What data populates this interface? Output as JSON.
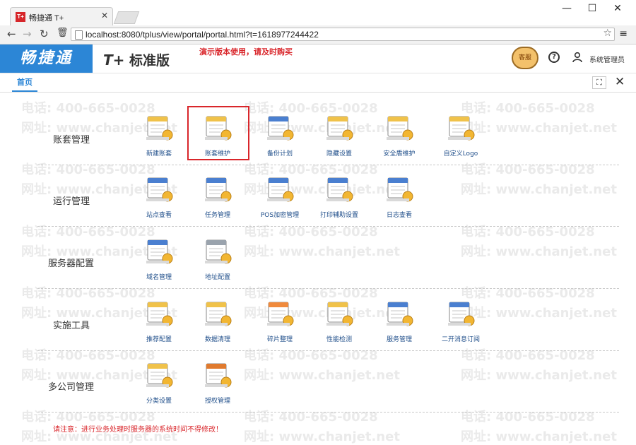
{
  "browser": {
    "tab_title": "畅捷通 T+",
    "tab_logo": "T+",
    "url": "localhost:8080/tplus/view/portal/portal.html?t=1618977244422",
    "window_controls": {
      "minimize": "—",
      "maximize": "☐",
      "close": "✕"
    }
  },
  "header": {
    "brand": "畅捷通",
    "edition_t": "T+",
    "edition": "标准版",
    "demo_notice": "演示版本使用，请及时购买",
    "kefu_label": "客服",
    "user": "系统管理员"
  },
  "tabs": {
    "home": "首页"
  },
  "watermark": {
    "phone": "电话: 400-665-0028",
    "site": "网址: www.chanjet.net"
  },
  "sections": [
    {
      "title": "账套管理",
      "tiles": [
        {
          "label": "新建账套",
          "icon": "new-account-icon"
        },
        {
          "label": "账套维护",
          "icon": "account-maintenance-icon"
        },
        {
          "label": "备份计划",
          "icon": "backup-plan-icon"
        },
        {
          "label": "隐藏设置",
          "icon": "hidden-settings-icon"
        },
        {
          "label": "安全盾维护",
          "icon": "security-shield-icon"
        },
        {
          "label": "自定义Logo",
          "icon": "custom-logo-icon"
        }
      ]
    },
    {
      "title": "运行管理",
      "tiles": [
        {
          "label": "站点查看",
          "icon": "site-view-icon"
        },
        {
          "label": "任务管理",
          "icon": "task-management-icon"
        },
        {
          "label": "POS加密管理",
          "icon": "pos-encryption-icon"
        },
        {
          "label": "打印辅助设置",
          "icon": "print-assist-icon"
        },
        {
          "label": "日志查看",
          "icon": "log-view-icon"
        }
      ]
    },
    {
      "title": "服务器配置",
      "tiles": [
        {
          "label": "域名管理",
          "icon": "domain-management-icon"
        },
        {
          "label": "地址配置",
          "icon": "address-config-icon"
        }
      ]
    },
    {
      "title": "实施工具",
      "tiles": [
        {
          "label": "推荐配置",
          "icon": "recommend-config-icon"
        },
        {
          "label": "数据清理",
          "icon": "data-cleanup-icon"
        },
        {
          "label": "碎片整理",
          "icon": "defrag-icon"
        },
        {
          "label": "性能检测",
          "icon": "performance-check-icon"
        },
        {
          "label": "服务管理",
          "icon": "service-management-icon"
        },
        {
          "label": "二开消息订阅",
          "icon": "message-subscription-icon"
        }
      ]
    },
    {
      "title": "多公司管理",
      "tiles": [
        {
          "label": "分类设置",
          "icon": "category-settings-icon"
        },
        {
          "label": "授权管理",
          "icon": "license-management-icon"
        }
      ]
    }
  ],
  "footer_note": "请注意：进行业务处理时服务器的系统时间不得修改！",
  "colors": {
    "brand_blue": "#2c86d6",
    "alert_red": "#d9262b",
    "label_blue": "#1f4e8a"
  }
}
